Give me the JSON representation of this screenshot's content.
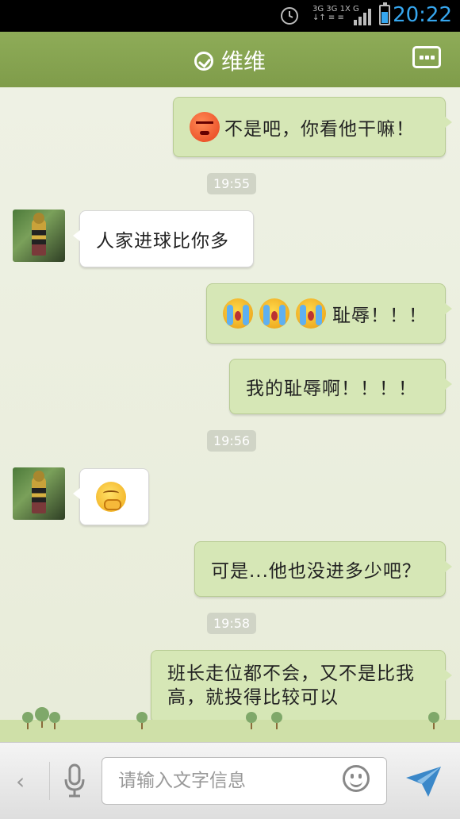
{
  "status_bar": {
    "time": "20:22",
    "network": [
      "3G 3G 1X G",
      "↓↑ ≡ ≡"
    ]
  },
  "header": {
    "title": "维维"
  },
  "messages": [
    {
      "type": "out",
      "text": "不是吧，你看他干嘛！",
      "emoji": "angry-face-icon"
    },
    {
      "type": "time",
      "text": "19:55"
    },
    {
      "type": "in",
      "text": "人家进球比你多"
    },
    {
      "type": "out",
      "text": "耻辱！！！",
      "emoji": "crying-face-icon x3"
    },
    {
      "type": "out",
      "text": "我的耻辱啊！！！！"
    },
    {
      "type": "time",
      "text": "19:56"
    },
    {
      "type": "in",
      "text": "",
      "emoji": "shy-face-icon"
    },
    {
      "type": "out",
      "text": "可是...他也没进多少吧？"
    },
    {
      "type": "time",
      "text": "19:58"
    },
    {
      "type": "out",
      "text": "班长走位都不会，又不是比我高，就投得比较可以"
    }
  ],
  "input": {
    "placeholder": "请输入文字信息"
  },
  "colors": {
    "header": "#86a451",
    "bubble_out": "#d6e7b6",
    "bubble_in": "#ffffff",
    "time_accent": "#36a6ee"
  }
}
